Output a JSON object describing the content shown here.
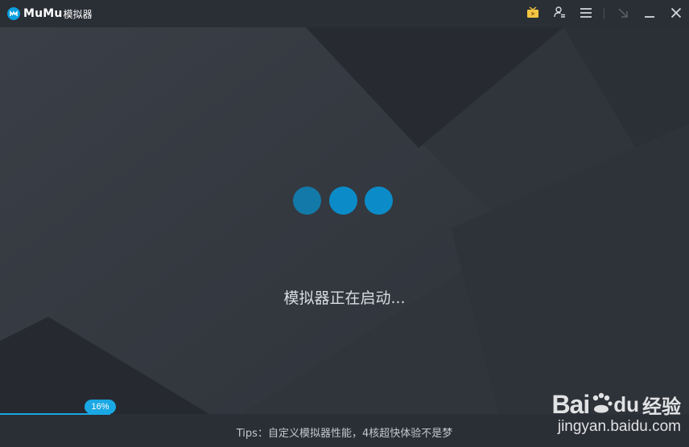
{
  "app": {
    "logo_text": "MuMu",
    "logo_sub": "模拟器"
  },
  "titlebar": {
    "icons": [
      "tv-icon",
      "user-settings-icon",
      "menu-icon",
      "collapse-icon",
      "minimize-icon",
      "close-icon"
    ]
  },
  "main": {
    "status_text": "模拟器正在启动..."
  },
  "progress": {
    "value_percent": 16,
    "label": "16%"
  },
  "footer": {
    "tips": "Tips：自定义模拟器性能，4核超快体验不是梦"
  },
  "watermark": {
    "bai": "Bai",
    "du": "du",
    "cn": "经验",
    "url": "jingyan.baidu.com"
  },
  "colors": {
    "accent": "#1aa8e4",
    "dot": "#0b8cc8",
    "background": "#31353d"
  }
}
